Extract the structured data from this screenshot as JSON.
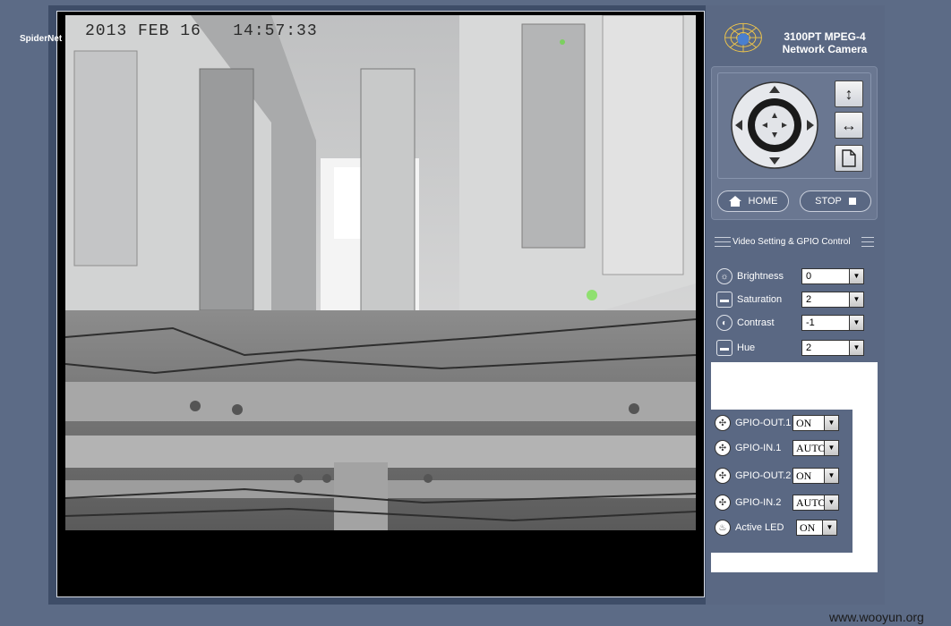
{
  "video": {
    "osd_date": "2013 FEB 16",
    "osd_time": "14:57:33"
  },
  "brand": {
    "logo_text": "SpiderNet",
    "model_line1": "3100PT  MPEG-4",
    "model_line2": "Network Camera"
  },
  "ptz": {
    "home_label": "HOME",
    "stop_label": "STOP"
  },
  "video_setting": {
    "title": "Video Setting & GPIO Control",
    "controls": [
      {
        "label": "Brightness",
        "value": "0",
        "icon": "brightness-icon"
      },
      {
        "label": "Saturation",
        "value": "2",
        "icon": "saturation-icon"
      },
      {
        "label": "Contrast",
        "value": "-1",
        "icon": "contrast-icon"
      },
      {
        "label": "Hue",
        "value": "2",
        "icon": "hue-icon"
      }
    ]
  },
  "gpio": {
    "items": [
      {
        "label": "GPIO-OUT.1",
        "value": "ON"
      },
      {
        "label": "GPIO-IN.1",
        "value": "AUTO"
      },
      {
        "label": "GPIO-OUT.2",
        "value": "ON"
      },
      {
        "label": "GPIO-IN.2",
        "value": "AUTO"
      },
      {
        "label": "Active LED",
        "value": "ON"
      }
    ]
  },
  "watermark": "www.wooyun.org"
}
